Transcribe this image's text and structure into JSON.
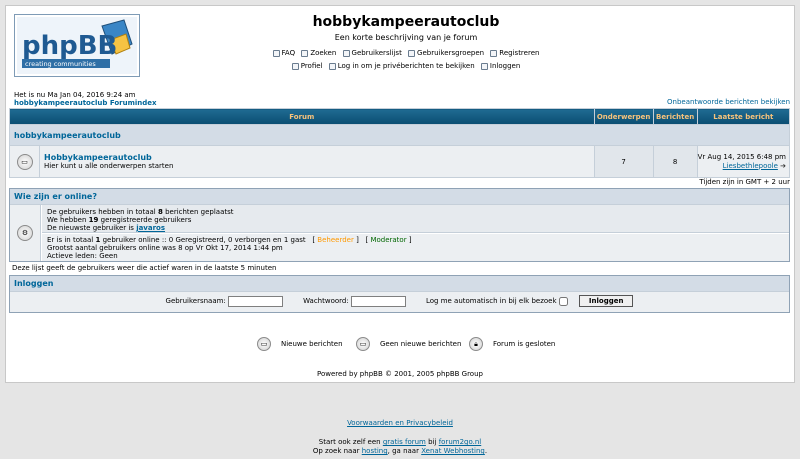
{
  "header": {
    "logo_main": "phpBB",
    "logo_sub": "creating communities",
    "site_title": "hobbykampeerautoclub",
    "site_desc": "Een korte beschrijving van je forum"
  },
  "nav": {
    "row1": [
      {
        "label": "FAQ",
        "icon": "help-icon"
      },
      {
        "label": "Zoeken",
        "icon": "search-icon"
      },
      {
        "label": "Gebruikerslijst",
        "icon": "members-icon"
      },
      {
        "label": "Gebruikersgroepen",
        "icon": "groups-icon"
      },
      {
        "label": "Registreren",
        "icon": "register-icon"
      }
    ],
    "row2": [
      {
        "label": "Profiel",
        "icon": "profile-icon"
      },
      {
        "label": "Log in om je privéberichten te bekijken",
        "icon": "pm-icon"
      },
      {
        "label": "Inloggen",
        "icon": "login-icon"
      }
    ]
  },
  "info": {
    "current_time": "Het is nu Ma Jan 04, 2016 9:24 am",
    "breadcrumb": "hobbykampeerautoclub Forumindex",
    "unanswered": "Onbeantwoorde berichten bekijken"
  },
  "table": {
    "headers": [
      "Forum",
      "Onderwerpen",
      "Berichten",
      "Laatste bericht"
    ],
    "category": "hobbykampeerautoclub",
    "forums": [
      {
        "name": "Hobbykampeerautoclub",
        "desc": "Hier kunt u alle onderwerpen starten",
        "topics": "7",
        "posts": "8",
        "last_date": "Vr Aug 14, 2015 6:48 pm",
        "last_user": "Liesbethlepoole"
      }
    ],
    "timezone": "Tijden zijn in GMT + 2 uur"
  },
  "online": {
    "title": "Wie zijn er online?",
    "line1_pre": "De gebruikers hebben in totaal ",
    "line1_num": "8",
    "line1_post": " berichten geplaatst",
    "line2_pre": "We hebben ",
    "line2_num": "19",
    "line2_post": " geregistreerde gebruikers",
    "line3_pre": "De nieuwste gebruiker is ",
    "line3_user": "javaros",
    "line4_pre": "Er is in totaal ",
    "line4_num": "1",
    "line4_post": " gebruiker online :: 0 Geregistreerd, 0 verborgen en 1 gast",
    "admin_label": "Beheerder",
    "mod_label": "Moderator",
    "line5": "Grootst aantal gebruikers online was 8 op Vr Okt 17, 2014 1:44 pm",
    "line6": "Actieve leden: Geen",
    "note": "Deze lijst geeft de gebruikers weer die actief waren in de laatste 5 minuten",
    "admin_color": "#ff9900",
    "mod_color": "#006600"
  },
  "login": {
    "title": "Inloggen",
    "username_label": "Gebruikersnaam:",
    "password_label": "Wachtwoord:",
    "auto_label": "Log me automatisch in bij elk bezoek",
    "button": "Inloggen"
  },
  "legend": {
    "new": "Nieuwe berichten",
    "none": "Geen nieuwe berichten",
    "locked": "Forum is gesloten"
  },
  "footer": {
    "powered": "Powered by phpBB © 2001, 2005 phpBB Group",
    "terms": "Voorwaarden en Privacybeleid",
    "start_pre": "Start ook zelf een ",
    "start_link": "gratis forum",
    "start_mid": " bij ",
    "start_link2": "forum2go.nl",
    "hosting_pre": "Op zoek naar ",
    "hosting_link": "hosting",
    "hosting_mid": ", ga naar ",
    "hosting_link2": "Xenat Webhosting",
    "hosting_post": "."
  }
}
